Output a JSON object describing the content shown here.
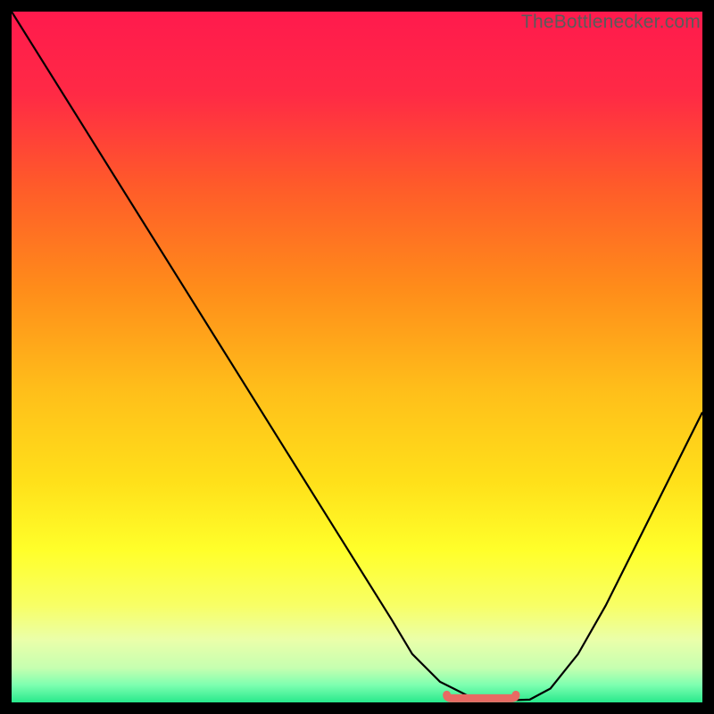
{
  "watermark": "TheBottlenecker.com",
  "colors": {
    "gradient_stops": [
      {
        "offset": 0.0,
        "color": "#ff1a4d"
      },
      {
        "offset": 0.12,
        "color": "#ff2a45"
      },
      {
        "offset": 0.25,
        "color": "#ff5a2a"
      },
      {
        "offset": 0.4,
        "color": "#ff8c1a"
      },
      {
        "offset": 0.55,
        "color": "#ffbf1a"
      },
      {
        "offset": 0.68,
        "color": "#ffe01a"
      },
      {
        "offset": 0.78,
        "color": "#ffff2a"
      },
      {
        "offset": 0.86,
        "color": "#f8ff66"
      },
      {
        "offset": 0.91,
        "color": "#eaffaa"
      },
      {
        "offset": 0.95,
        "color": "#c6ffb0"
      },
      {
        "offset": 0.975,
        "color": "#7dffb0"
      },
      {
        "offset": 1.0,
        "color": "#28e98c"
      }
    ],
    "curve": "#000000",
    "valley_marker": "#e86a63"
  },
  "chart_data": {
    "type": "line",
    "title": "",
    "xlabel": "",
    "ylabel": "",
    "xlim": [
      0,
      100
    ],
    "ylim": [
      0,
      100
    ],
    "grid": false,
    "series": [
      {
        "name": "bottleneck-curve",
        "x": [
          0,
          5,
          10,
          15,
          20,
          25,
          30,
          35,
          40,
          45,
          50,
          55,
          58,
          62,
          66,
          70,
          72,
          75,
          78,
          82,
          86,
          90,
          94,
          98,
          100
        ],
        "y": [
          100,
          92,
          84,
          76,
          68,
          60,
          52,
          44,
          36,
          28,
          20,
          12,
          7,
          3,
          1,
          0.4,
          0.3,
          0.4,
          2,
          7,
          14,
          22,
          30,
          38,
          42
        ]
      }
    ],
    "annotations": [
      {
        "name": "optimal-range-marker",
        "x_start": 63,
        "x_end": 73,
        "y": 0.6,
        "color": "#e86a63"
      }
    ]
  }
}
